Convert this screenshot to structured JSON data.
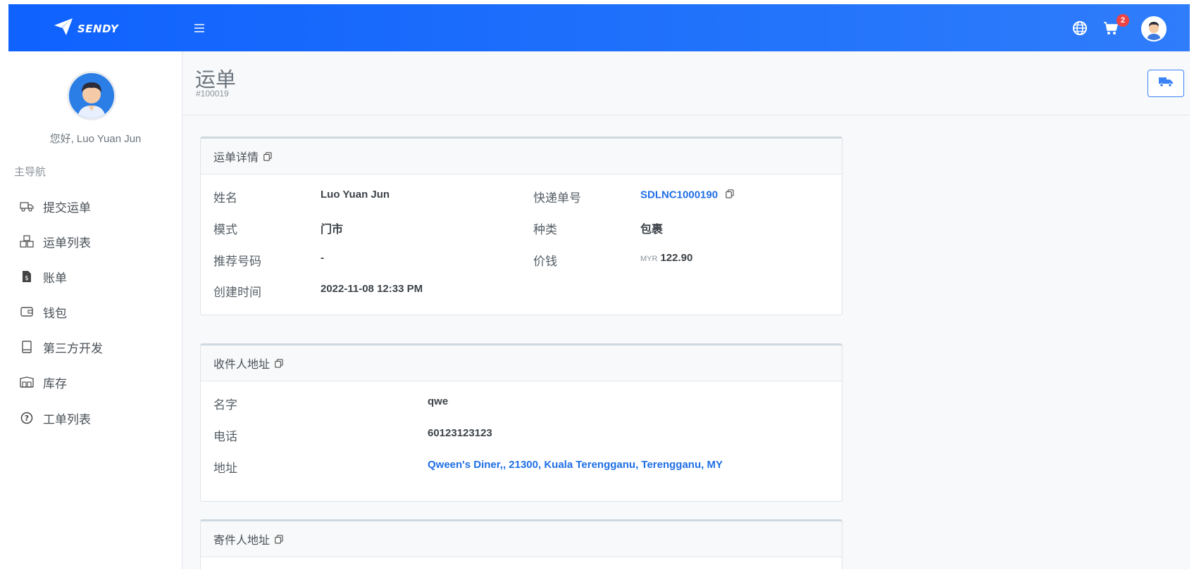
{
  "brand": {
    "name": "SENDY"
  },
  "topbar": {
    "cart_count": "2"
  },
  "sidebar": {
    "greeting": "您好, Luo Yuan Jun",
    "nav_title": "主导航",
    "items": [
      {
        "label": "提交运单",
        "icon": "truck-icon"
      },
      {
        "label": "运单列表",
        "icon": "boxes-icon"
      },
      {
        "label": "账单",
        "icon": "invoice-icon"
      },
      {
        "label": "钱包",
        "icon": "wallet-icon"
      },
      {
        "label": "第三方开发",
        "icon": "book-icon"
      },
      {
        "label": "库存",
        "icon": "warehouse-icon"
      },
      {
        "label": "工单列表",
        "icon": "help-icon"
      }
    ]
  },
  "header": {
    "title": "运单",
    "subtitle": "#100019"
  },
  "order": {
    "title": "运单详情",
    "name_label": "姓名",
    "name_value": "Luo Yuan Jun",
    "mode_label": "模式",
    "mode_value": "门市",
    "ref_label": "推荐号码",
    "ref_value": "-",
    "created_label": "创建时间",
    "created_value": "2022-11-08 12:33 PM",
    "tracking_label": "快递单号",
    "tracking_value": "SDLNC1000190",
    "type_label": "种类",
    "type_value": "包裹",
    "price_label": "价钱",
    "price_currency": "MYR",
    "price_value": "122.90"
  },
  "recipient": {
    "title": "收件人地址",
    "name_label": "名字",
    "name_value": "qwe",
    "phone_label": "电话",
    "phone_value": "60123123123",
    "address_label": "地址",
    "address_value": "Qween's Diner,, 21300, Kuala Terengganu, Terengganu, MY"
  },
  "sender": {
    "title": "寄件人地址"
  },
  "colors": {
    "primary": "#1e6ffb",
    "link": "#1f6fe5",
    "badge": "#ef4444"
  }
}
